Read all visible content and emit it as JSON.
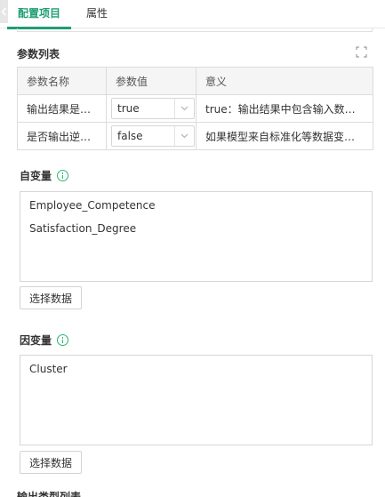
{
  "tabs": [
    {
      "label": "配置项目",
      "active": true
    },
    {
      "label": "属性",
      "active": false
    }
  ],
  "param_list": {
    "title": "参数列表",
    "columns": [
      "参数名称",
      "参数值",
      "意义"
    ],
    "rows": [
      {
        "name": "输出结果是否...",
        "value": "true",
        "meaning": "true：输出结果中包含输入数据及..."
      },
      {
        "name": "是否输出逆变换",
        "value": "false",
        "meaning": "如果模型来自标准化等数据变换操..."
      }
    ]
  },
  "independent": {
    "title": "自变量",
    "items": [
      "Employee_Competence",
      "Satisfaction_Degree"
    ],
    "button": "选择数据"
  },
  "dependent": {
    "title": "因变量",
    "items": [
      "Cluster"
    ],
    "button": "选择数据"
  },
  "output_section": {
    "title": "输出类型列表"
  },
  "colors": {
    "accent": "#1f9e73",
    "info": "#2bb673",
    "border": "#dcdcdc"
  },
  "icons": {
    "back": "chevron-left-icon",
    "expand": "expand-icon",
    "info": "info-icon",
    "dropdown": "chevron-down-icon"
  }
}
